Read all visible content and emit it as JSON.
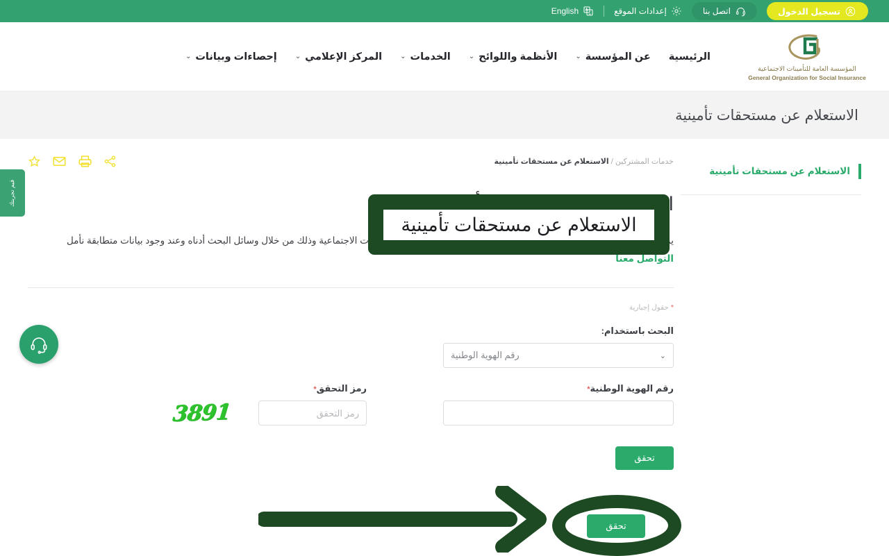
{
  "topbar": {
    "login_label": "تسجيل الدخول",
    "login_icon": "user-circle-icon",
    "contact_label": "اتصل بنا",
    "contact_icon": "headset-icon",
    "settings_label": "إعدادات الموقع",
    "settings_icon": "gear-icon",
    "language_label": "English",
    "language_icon": "translate-icon",
    "bg_color": "#34a270",
    "login_bg_color": "#e3e820"
  },
  "header": {
    "logo": {
      "arabic": "المؤسسة العامة للتأمينات الاجتماعية",
      "english": "General Organization for Social Insurance",
      "mark_icon": "gosi-spiral-logo-icon",
      "gold_color": "#8a7c4e",
      "green_color": "#2d7a4f"
    },
    "nav": [
      {
        "label": "الرئيسية",
        "has_dropdown": false
      },
      {
        "label": "عن المؤسسة",
        "has_dropdown": true
      },
      {
        "label": "الأنظمة واللوائح",
        "has_dropdown": true
      },
      {
        "label": "الخدمات",
        "has_dropdown": true
      },
      {
        "label": "المركز الإعلامي",
        "has_dropdown": true
      },
      {
        "label": "إحصاءات وبيانات",
        "has_dropdown": true
      }
    ],
    "chevron_glyph": "⌄"
  },
  "banner": {
    "title": "الاستعلام عن مستحقات تأمينية",
    "bg_color": "#f3f3f4"
  },
  "sidebar": {
    "items": [
      {
        "label": "الاستعلام عن مستحقات تأمينية",
        "active": true
      }
    ],
    "accent_color": "#2bab6b"
  },
  "breadcrumb": {
    "parent": "خدمات المشتركين",
    "separator": "/",
    "current": "الاستعلام عن مستحقات تأمينية"
  },
  "page_actions": [
    {
      "icon": "star-icon",
      "name": "favorite"
    },
    {
      "icon": "envelope-icon",
      "name": "email"
    },
    {
      "icon": "printer-icon",
      "name": "print"
    },
    {
      "icon": "share-icon",
      "name": "share"
    }
  ],
  "page_actions_color": "#f2e02c",
  "main": {
    "title": "الاستعلام عن مستحقات تأمينية",
    "description_before": "يمكن التحقق من وجود مستحقات تأمينية لم تصرف لدى المؤسسة العامة للتأمينات الاجتماعية وذلك من خلال وسائل البحث أدناه وعند وجود بيانات متطابقة نأمل ",
    "description_link": "التواصل معنا",
    "required_note_star": "*",
    "required_note": "حقول إجبارية",
    "search_by_label": "البحث باستخدام:",
    "search_by_value": "رقم الهوية الوطنية",
    "search_by_options": [
      "رقم الهوية الوطنية"
    ],
    "national_id_label": "رقم الهوية الوطنية",
    "national_id_value": "",
    "national_id_placeholder": "",
    "captcha_label": "رمز التحقق",
    "captcha_value": "",
    "captcha_placeholder": "رمز التحقق",
    "captcha_image_text": "3891",
    "captcha_color": "#2ec32e",
    "submit_label": "تحقق",
    "submit_color": "#2bab6b"
  },
  "floating": {
    "rate_tab_label": "قيم تجربتك",
    "support_icon": "headset-icon",
    "support_color": "#2aa06d"
  },
  "annotations": {
    "highlight_color": "#1d4a22",
    "title_box_text": "الاستعلام عن مستحقات تأمينية",
    "arrow_icon": "right-arrow-annotation-icon",
    "circle_icon": "ellipse-highlight-annotation-icon",
    "circled_button_label": "تحقق"
  }
}
